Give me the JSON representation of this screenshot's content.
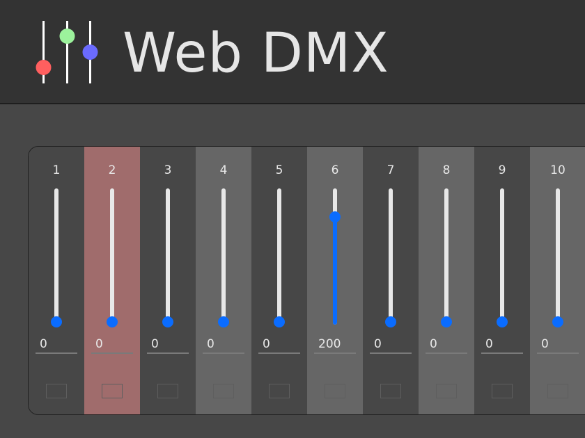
{
  "app": {
    "title": "Web DMX"
  },
  "colors": {
    "header_bg": "#333333",
    "page_bg": "#474747",
    "accent": "#0a6cff",
    "selected_channel": "#a06c6c",
    "logo_red": "#ff5f5f",
    "logo_green": "#9cf29c",
    "logo_blue": "#6b6bff"
  },
  "icons": {
    "logo": "mixer-faders-icon"
  },
  "max_value": 255,
  "channels": [
    {
      "label": "1",
      "value": 0,
      "bg": "#474747",
      "selected": false
    },
    {
      "label": "2",
      "value": 0,
      "bg": "#a06c6c",
      "selected": true
    },
    {
      "label": "3",
      "value": 0,
      "bg": "#474747",
      "selected": false
    },
    {
      "label": "4",
      "value": 0,
      "bg": "#666666",
      "selected": false
    },
    {
      "label": "5",
      "value": 0,
      "bg": "#474747",
      "selected": false
    },
    {
      "label": "6",
      "value": 200,
      "bg": "#666666",
      "selected": false
    },
    {
      "label": "7",
      "value": 0,
      "bg": "#474747",
      "selected": false
    },
    {
      "label": "8",
      "value": 0,
      "bg": "#666666",
      "selected": false
    },
    {
      "label": "9",
      "value": 0,
      "bg": "#474747",
      "selected": false
    },
    {
      "label": "10",
      "value": 0,
      "bg": "#666666",
      "selected": false
    }
  ]
}
